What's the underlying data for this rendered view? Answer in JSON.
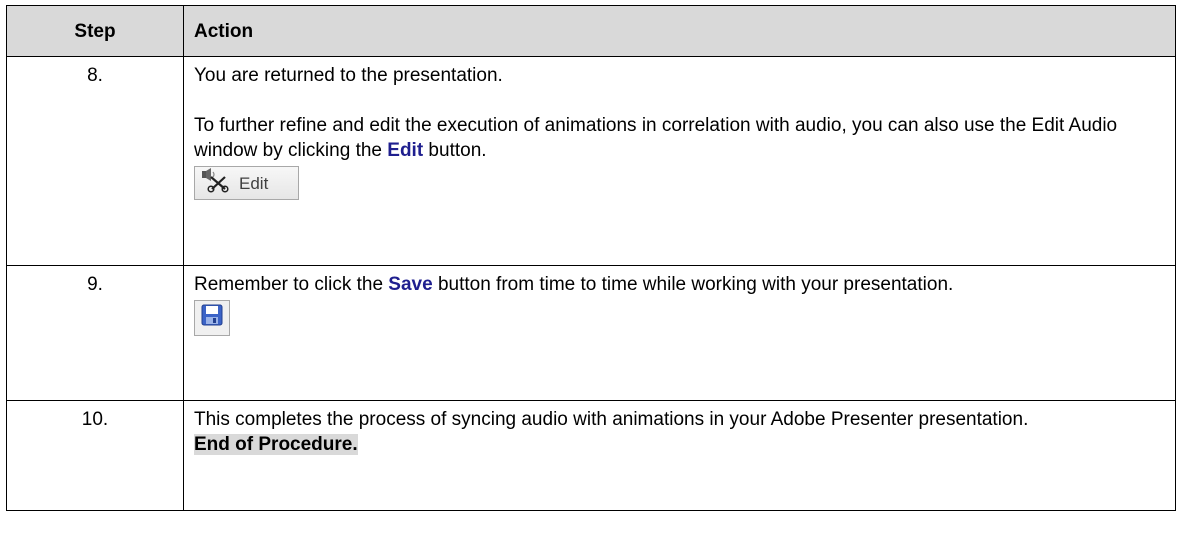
{
  "header": {
    "step": "Step",
    "action": "Action"
  },
  "rows": [
    {
      "step": "8.",
      "line1": "You are returned to the presentation.",
      "line2a": "To further refine and edit the execution of animations in correlation with audio, you can also use the Edit Audio window by clicking the ",
      "keyword": "Edit",
      "line2b": " button.",
      "image_label": "Edit",
      "image_icon": "audio-edit-scissors-icon"
    },
    {
      "step": "9.",
      "text_a": "Remember to click the ",
      "keyword": "Save",
      "text_b": " button from time to time while working with your presentation.",
      "image_icon": "save-floppy-icon"
    },
    {
      "step": "10.",
      "text": "This completes the process of syncing audio with animations in your Adobe Presenter presentation.",
      "end": "End of Procedure."
    }
  ],
  "colors": {
    "header_bg": "#d9d9d9",
    "keyword": "#1f1f8f"
  }
}
